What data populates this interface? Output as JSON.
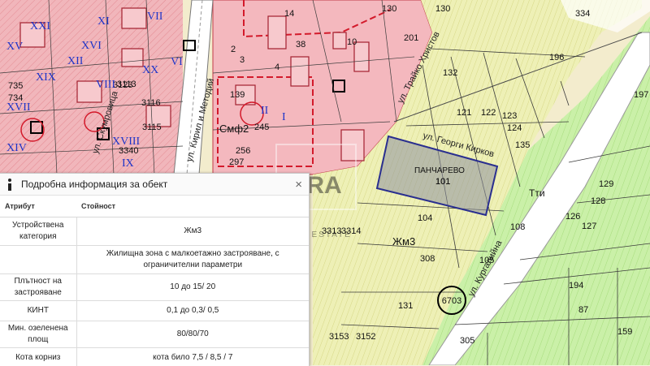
{
  "map": {
    "parcels": [
      "334",
      "196",
      "130",
      "132",
      "121",
      "122",
      "123",
      "124",
      "135",
      "201",
      "38",
      "10",
      "14",
      "4",
      "2",
      "3",
      "139",
      "245",
      "256",
      "297",
      "131",
      "104",
      "101",
      "105",
      "308",
      "108",
      "194",
      "87",
      "159",
      "129",
      "128",
      "126",
      "127",
      "197",
      "3313",
      "3314",
      "3123",
      "3113",
      "3116",
      "3115",
      "3340",
      "3153",
      "3152",
      "305",
      "130",
      "735",
      "734"
    ],
    "roman_numerals": [
      "XXI",
      "XIX",
      "XVII",
      "XIV",
      "XII",
      "VIII",
      "VII",
      "VI",
      "II",
      "I",
      "XI",
      "XX",
      "XV",
      "XVI",
      "XVIII",
      "IX"
    ],
    "zones": {
      "zhm3_a": "Жм3",
      "zhm3_b": "Жм3",
      "smf2": "Смф2",
      "tti": "Тти"
    },
    "area_name": "ПАНЧАРЕВО",
    "selected_parcel": "101",
    "circled_block": "6703",
    "streets": {
      "kiril_metodiy": "ул. Кирил и Методий",
      "georgi_kirkov": "ул. Георги Кирков",
      "ulica_left": "ул. Скумровица",
      "ulica_bottom": "ул. Кургалийна",
      "ulica_top": "ул. Трайко Христов"
    },
    "watermark": {
      "mark": "ERA",
      "sub": "REAL ESTATE"
    },
    "colors": {
      "residential": "#f3b2b8",
      "agricultural": "#ecefb0",
      "green": "#c8efa3",
      "road_pink": "#d31a2b",
      "selection": "#2a2f8f"
    }
  },
  "panel": {
    "title": "Подробна информация за обект",
    "close": "×",
    "headers": {
      "attribute": "Атрибут",
      "value": "Стойност"
    },
    "rows": [
      {
        "attribute": "Устройствена категория",
        "value": "Жм3"
      },
      {
        "attribute": "",
        "value": "Жилищна зона с малкоетажно застрояване, с ограничителни параметри"
      },
      {
        "attribute": "Плътност на застрояване",
        "value": "10 до 15/ 20"
      },
      {
        "attribute": "КИНТ",
        "value": "0,1 до 0,3/ 0,5"
      },
      {
        "attribute": "Мин. озеленена площ",
        "value": "80/80/70"
      },
      {
        "attribute": "Кота корниз",
        "value": "кота било 7,5 / 8,5 / 7"
      }
    ]
  }
}
